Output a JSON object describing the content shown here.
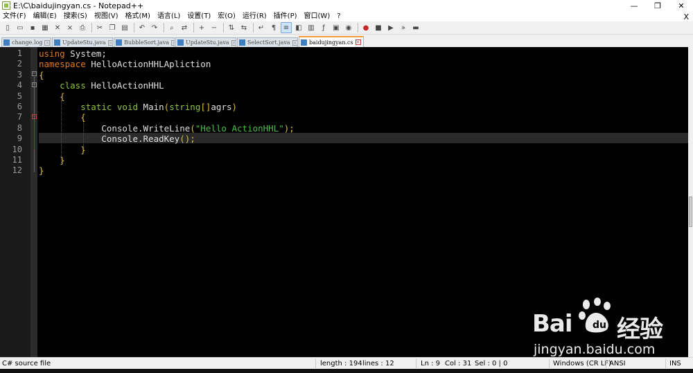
{
  "window": {
    "title": "E:\\C\\baidujingyan.cs - Notepad++",
    "minimize_glyph": "—",
    "maximize_glyph": "❐",
    "close_glyph": "✕"
  },
  "menu": {
    "items": [
      "文件(F)",
      "编辑(E)",
      "搜索(S)",
      "视图(V)",
      "格式(M)",
      "语言(L)",
      "设置(T)",
      "宏(O)",
      "运行(R)",
      "插件(P)",
      "窗口(W)",
      "?"
    ],
    "close_label": "X"
  },
  "tabs": [
    {
      "label": "change.log",
      "active": false
    },
    {
      "label": "UpdateStu.java",
      "active": false
    },
    {
      "label": "BubbleSort.java",
      "active": false
    },
    {
      "label": "UpdateStu.java",
      "active": false
    },
    {
      "label": "SelectSort.java",
      "active": false
    },
    {
      "label": "baidujingyan.cs",
      "active": true
    }
  ],
  "editor": {
    "line_numbers": [
      "1",
      "2",
      "3",
      "4",
      "5",
      "6",
      "7",
      "8",
      "9",
      "10",
      "11",
      "12"
    ],
    "current_line": 9,
    "lines": [
      [
        {
          "t": "using",
          "c": "kw"
        },
        {
          "t": " System;",
          "c": ""
        }
      ],
      [
        {
          "t": "namespace",
          "c": "kw"
        },
        {
          "t": " HelloActionHHLApliction",
          "c": ""
        }
      ],
      [
        {
          "t": "{",
          "c": "brace"
        }
      ],
      [
        {
          "t": "    ",
          "c": ""
        },
        {
          "t": "class",
          "c": "kw-green"
        },
        {
          "t": " HelloActionHHL",
          "c": ""
        }
      ],
      [
        {
          "t": "    ",
          "c": ""
        },
        {
          "t": "{",
          "c": "brace"
        }
      ],
      [
        {
          "t": "        ",
          "c": ""
        },
        {
          "t": "static",
          "c": "kw-green"
        },
        {
          "t": " ",
          "c": ""
        },
        {
          "t": "void",
          "c": "kw-green"
        },
        {
          "t": " Main",
          "c": ""
        },
        {
          "t": "(",
          "c": "brace"
        },
        {
          "t": "string",
          "c": "kw-green"
        },
        {
          "t": "[]",
          "c": "brace"
        },
        {
          "t": "agrs",
          "c": ""
        },
        {
          "t": ")",
          "c": "brace"
        }
      ],
      [
        {
          "t": "        ",
          "c": ""
        },
        {
          "t": "{",
          "c": "brace"
        }
      ],
      [
        {
          "t": "            Console.WriteLine",
          "c": ""
        },
        {
          "t": "(",
          "c": "brace"
        },
        {
          "t": "\"Hello ActionHHL\"",
          "c": "str"
        },
        {
          "t": ");",
          "c": "brace"
        }
      ],
      [
        {
          "t": "            Console.ReadKey",
          "c": ""
        },
        {
          "t": "();",
          "c": "brace"
        }
      ],
      [
        {
          "t": "        ",
          "c": ""
        },
        {
          "t": "}",
          "c": "brace"
        }
      ],
      [
        {
          "t": "    ",
          "c": ""
        },
        {
          "t": "}",
          "c": "brace"
        }
      ],
      [
        {
          "t": "}",
          "c": "brace"
        }
      ]
    ]
  },
  "status": {
    "file_type": "C# source file",
    "length": "length : 194",
    "lines": "lines : 12",
    "ln": "Ln : 9",
    "col": "Col : 31",
    "sel": "Sel : 0 | 0",
    "eol": "Windows (CR LF)",
    "encoding": "ANSI",
    "mode": "INS"
  },
  "watermark": {
    "brand": "Bai",
    "brand2": "经验",
    "sub": "jingyan.baidu.com"
  },
  "toolbar": {
    "icons": [
      "new-icon",
      "open-icon",
      "save-icon",
      "save-all-icon",
      "close-icon",
      "close-all-icon",
      "print-icon",
      "sep",
      "cut-icon",
      "copy-icon",
      "paste-icon",
      "sep",
      "undo-icon",
      "redo-icon",
      "sep",
      "find-icon",
      "replace-icon",
      "sep",
      "zoom-in-icon",
      "zoom-out-icon",
      "sep",
      "sync-v-icon",
      "sync-h-icon",
      "sep",
      "word-wrap-icon",
      "show-all-chars-icon",
      "indent-guide-icon",
      "user-lang-icon",
      "doc-map-icon",
      "function-list-icon",
      "folder-workspace-icon",
      "monitor-icon",
      "sep",
      "record-macro-icon",
      "stop-record-icon",
      "play-macro-icon",
      "run-macro-multiple-icon",
      "save-macro-icon"
    ]
  }
}
